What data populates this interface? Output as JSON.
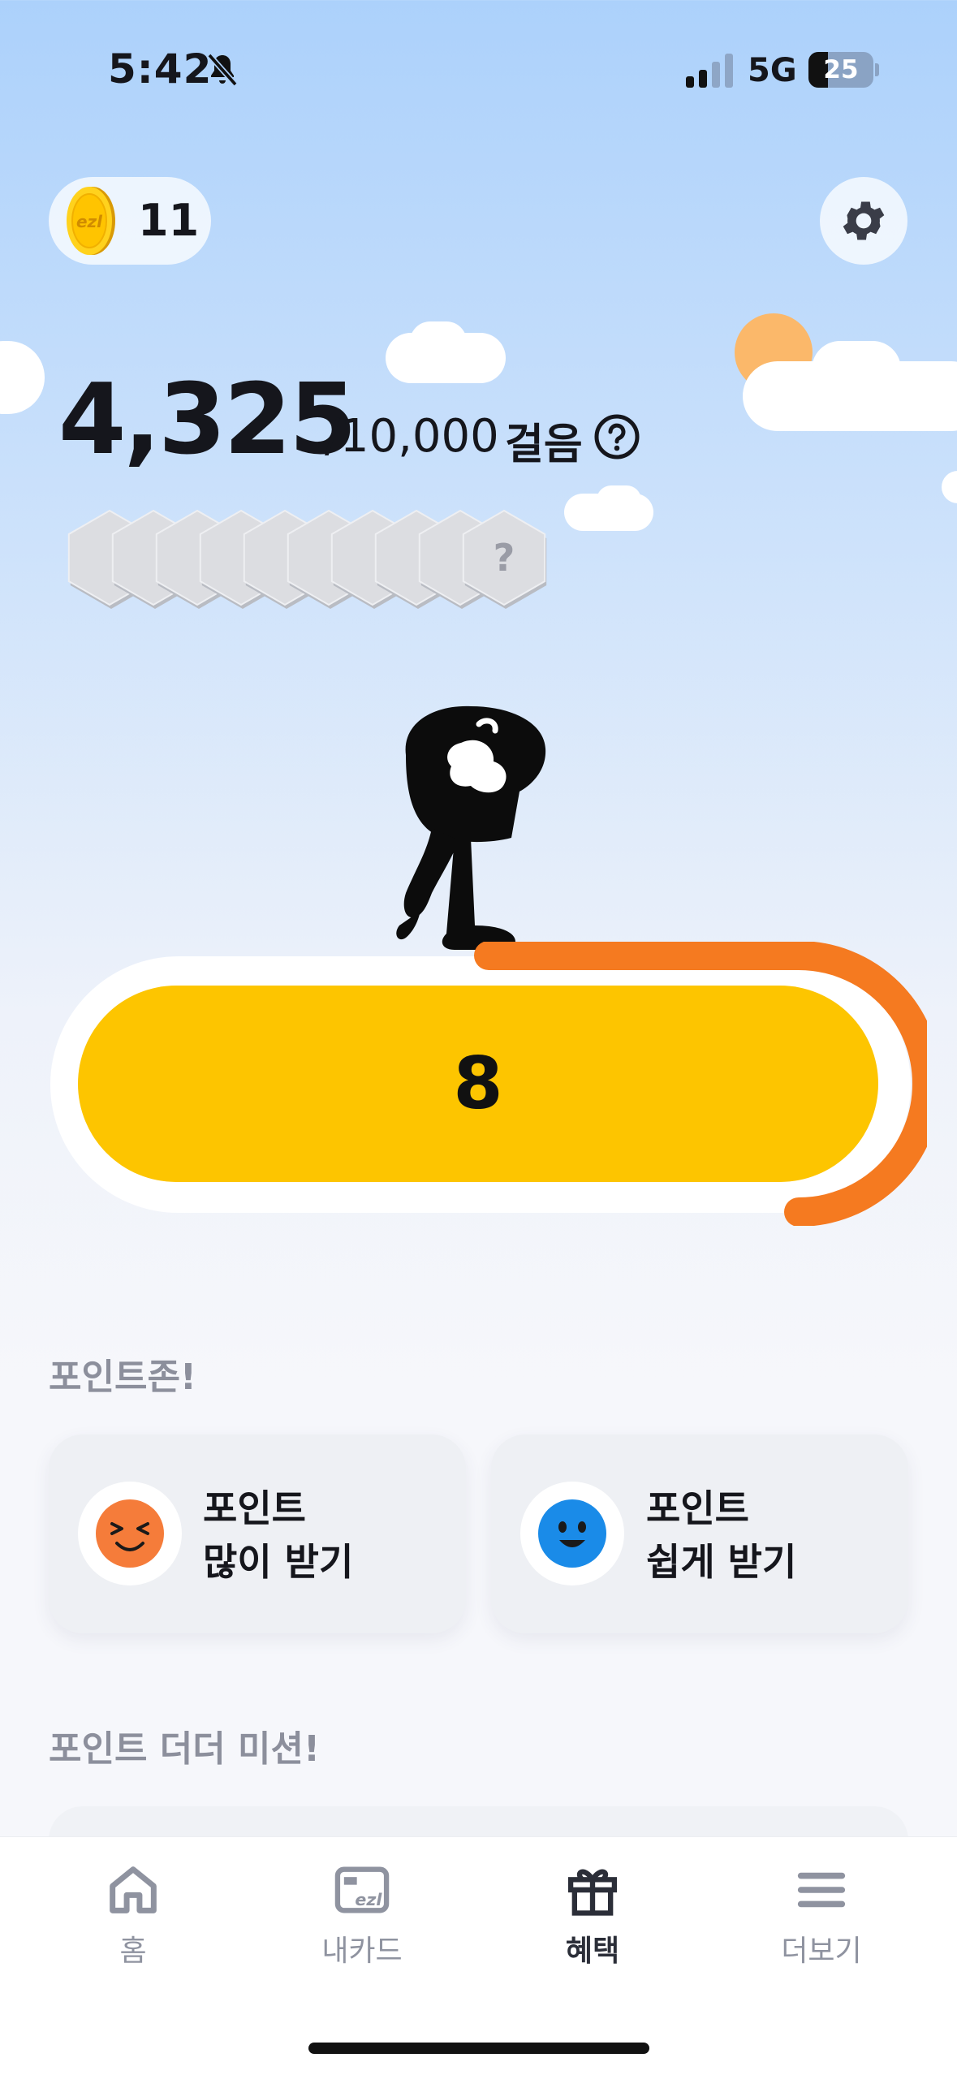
{
  "status_bar": {
    "time": "5:42",
    "network": "5G",
    "battery": "25",
    "icons": [
      "bell-slash-icon",
      "signal-icon",
      "battery-icon"
    ]
  },
  "header": {
    "coin_count": "11",
    "coin_logo_text": "ezl",
    "coin_icon": "coin-icon",
    "settings_icon": "gear-icon"
  },
  "steps": {
    "current": "4,325",
    "goal": "/10,000",
    "unit": "걸음",
    "help_icon": "question-circle-icon",
    "badge_count": 10,
    "badge_last_label": "?"
  },
  "progress": {
    "value": "8",
    "fraction": 0.4325,
    "colors": {
      "bar": "#fdc500",
      "progress": "#f57a20"
    }
  },
  "point_zone": {
    "title": "포인트존!",
    "cards": [
      {
        "line1": "포인트",
        "line2": "많이 받기",
        "icon": "laughing-face-icon",
        "color": "#f57c3a"
      },
      {
        "line1": "포인트",
        "line2": "쉽게 받기",
        "icon": "smiling-face-icon",
        "color": "#1a8be8"
      }
    ]
  },
  "missions": {
    "title": "포인트 더더 미션!"
  },
  "bottom_nav": {
    "items": [
      {
        "label": "홈",
        "icon": "home-icon"
      },
      {
        "label": "내카드",
        "icon": "card-icon"
      },
      {
        "label": "혜택",
        "icon": "gift-icon",
        "active": true
      },
      {
        "label": "더보기",
        "icon": "menu-icon"
      }
    ]
  }
}
